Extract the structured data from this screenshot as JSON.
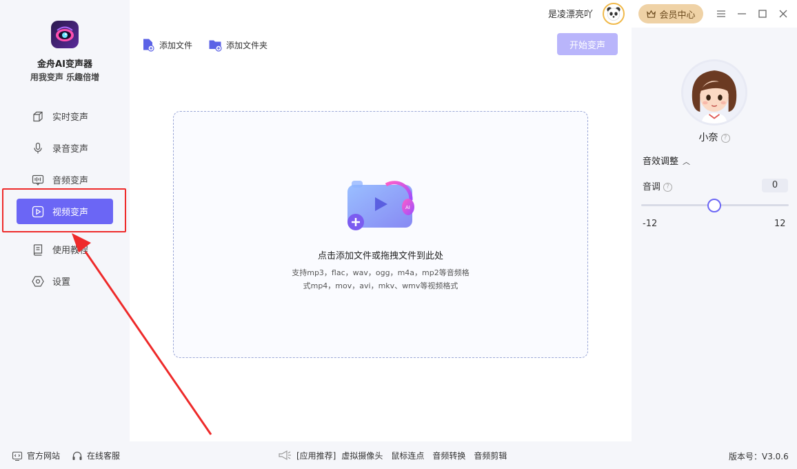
{
  "sidebar": {
    "app_name": "金舟AI变声器",
    "slogan": "用我变声 乐趣倍增",
    "items": [
      {
        "label": "实时变声",
        "icon": "cube-icon"
      },
      {
        "label": "录音变声",
        "icon": "microphone-icon"
      },
      {
        "label": "音频变声",
        "icon": "audio-wave-icon"
      },
      {
        "label": "视频变声",
        "icon": "video-play-icon",
        "active": true
      },
      {
        "label": "使用教程",
        "icon": "book-icon"
      },
      {
        "label": "设置",
        "icon": "settings-hexagon-icon"
      }
    ]
  },
  "toolbar": {
    "add_file": "添加文件",
    "add_folder": "添加文件夹",
    "start": "开始变声"
  },
  "dropzone": {
    "title": "点击添加文件或拖拽文件到此处",
    "hint_line1": "支持mp3，flac，wav，ogg，m4a，mp2等音频格",
    "hint_line2": "式mp4，mov，avi，mkv、wmv等视频格式"
  },
  "topbar": {
    "username": "是凌漂亮吖",
    "vip": "会员中心"
  },
  "right_panel": {
    "voice_name": "小奈",
    "section_title": "音效调整",
    "pitch_label": "音调",
    "pitch_value": "0",
    "pitch_fraction": 0.5,
    "slider_min": "-12",
    "slider_max": "12"
  },
  "footer": {
    "website": "官方网站",
    "support": "在线客服",
    "recommend_prefix": "[应用推荐]",
    "recommend": [
      "虚拟摄像头",
      "鼠标连点",
      "音频转换",
      "音频剪辑"
    ],
    "version": "版本号：V3.0.6"
  },
  "colors": {
    "accent": "#6b66f5",
    "accent_disabled": "#b9b5fb",
    "vip_bg": "#efd2a6",
    "annotation": "#ee2a2a"
  }
}
